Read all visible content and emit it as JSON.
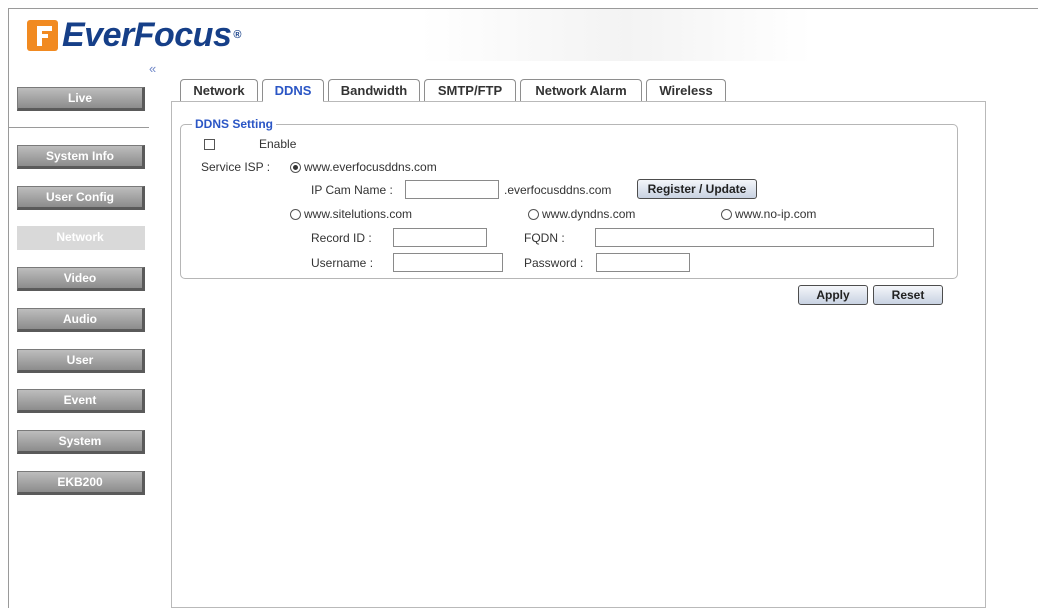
{
  "brand": {
    "name_part1": "Ever",
    "name_part2": "Focus",
    "registered": "®"
  },
  "sidebar": {
    "collapse_symbol": "«",
    "items": [
      {
        "label": "Live"
      },
      {
        "label": "System Info"
      },
      {
        "label": "User Config"
      },
      {
        "label": "Network",
        "active": true
      },
      {
        "label": "Video"
      },
      {
        "label": "Audio"
      },
      {
        "label": "User"
      },
      {
        "label": "Event"
      },
      {
        "label": "System"
      },
      {
        "label": "EKB200"
      }
    ]
  },
  "tabs": [
    {
      "label": "Network"
    },
    {
      "label": "DDNS",
      "active": true
    },
    {
      "label": "Bandwidth"
    },
    {
      "label": "SMTP/FTP"
    },
    {
      "label": "Network Alarm"
    },
    {
      "label": "Wireless"
    }
  ],
  "ddns": {
    "legend": "DDNS Setting",
    "enable_label": "Enable",
    "enable_checked": false,
    "service_isp_label": "Service ISP :",
    "isp_options": {
      "everfocus": {
        "label": "www.everfocusddns.com",
        "selected": true
      },
      "sitelutions": {
        "label": "www.sitelutions.com",
        "selected": false
      },
      "dyndns": {
        "label": "www.dyndns.com",
        "selected": false
      },
      "noip": {
        "label": "www.no-ip.com",
        "selected": false
      }
    },
    "ip_cam_name_label": "IP Cam Name :",
    "ip_cam_name_value": "",
    "domain_suffix": ".everfocusddns.com",
    "register_button": "Register / Update",
    "record_id_label": "Record ID :",
    "record_id_value": "",
    "fqdn_label": "FQDN :",
    "fqdn_value": "",
    "username_label": "Username :",
    "username_value": "",
    "password_label": "Password :",
    "password_value": ""
  },
  "actions": {
    "apply": "Apply",
    "reset": "Reset"
  }
}
